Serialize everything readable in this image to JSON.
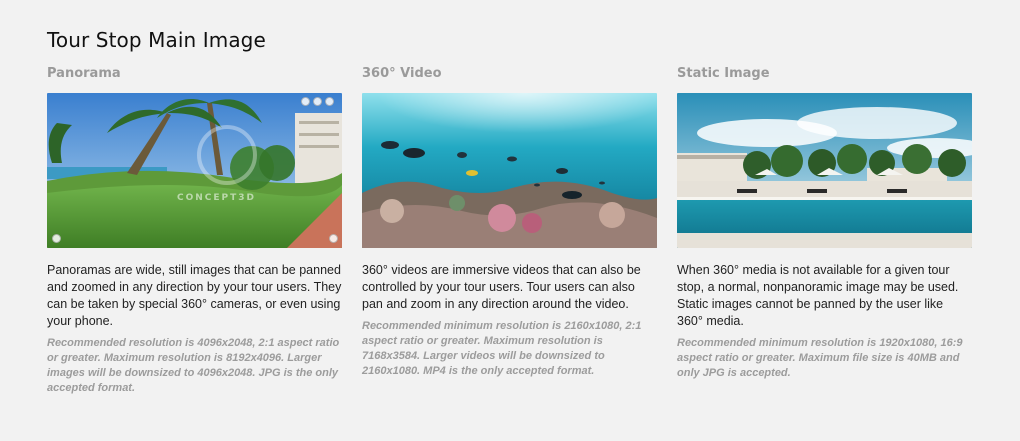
{
  "page": {
    "title": "Tour Stop Main Image"
  },
  "columns": [
    {
      "title": "Panorama",
      "description": "Panoramas are wide, still images that can be panned and zoomed in any direction by your tour users. They can be taken by special 360° cameras, or even using your phone.",
      "note": "Recommended resolution is 4096x2048, 2:1 aspect ratio or greater. Maximum resolution is 8192x4096. Larger images will be downsized to 4096x2048. JPG is the only accepted format.",
      "watermark": "CONCEPT3D"
    },
    {
      "title": "360° Video",
      "description": "360° videos are immersive videos that can also be controlled by your tour users. Tour users can also pan and zoom in any direction around the video.",
      "note": "Recommended minimum resolution is 2160x1080, 2:1 aspect ratio or greater. Maximum resolution is 7168x3584. Larger videos will be downsized to 2160x1080. MP4 is the only accepted format."
    },
    {
      "title": "Static Image",
      "description": "When 360° media is not available for a given tour stop, a normal, nonpanoramic image may be used. Static images cannot be panned by the user like 360° media.",
      "note": "Recommended minimum resolution is 1920x1080, 16:9 aspect ratio or greater. Maximum file size is 40MB and only JPG is accepted."
    }
  ],
  "colors": {
    "background": "#f2f2f2",
    "title": "#111111",
    "column_title": "#9a9a9a",
    "note": "#9c9c9c"
  }
}
